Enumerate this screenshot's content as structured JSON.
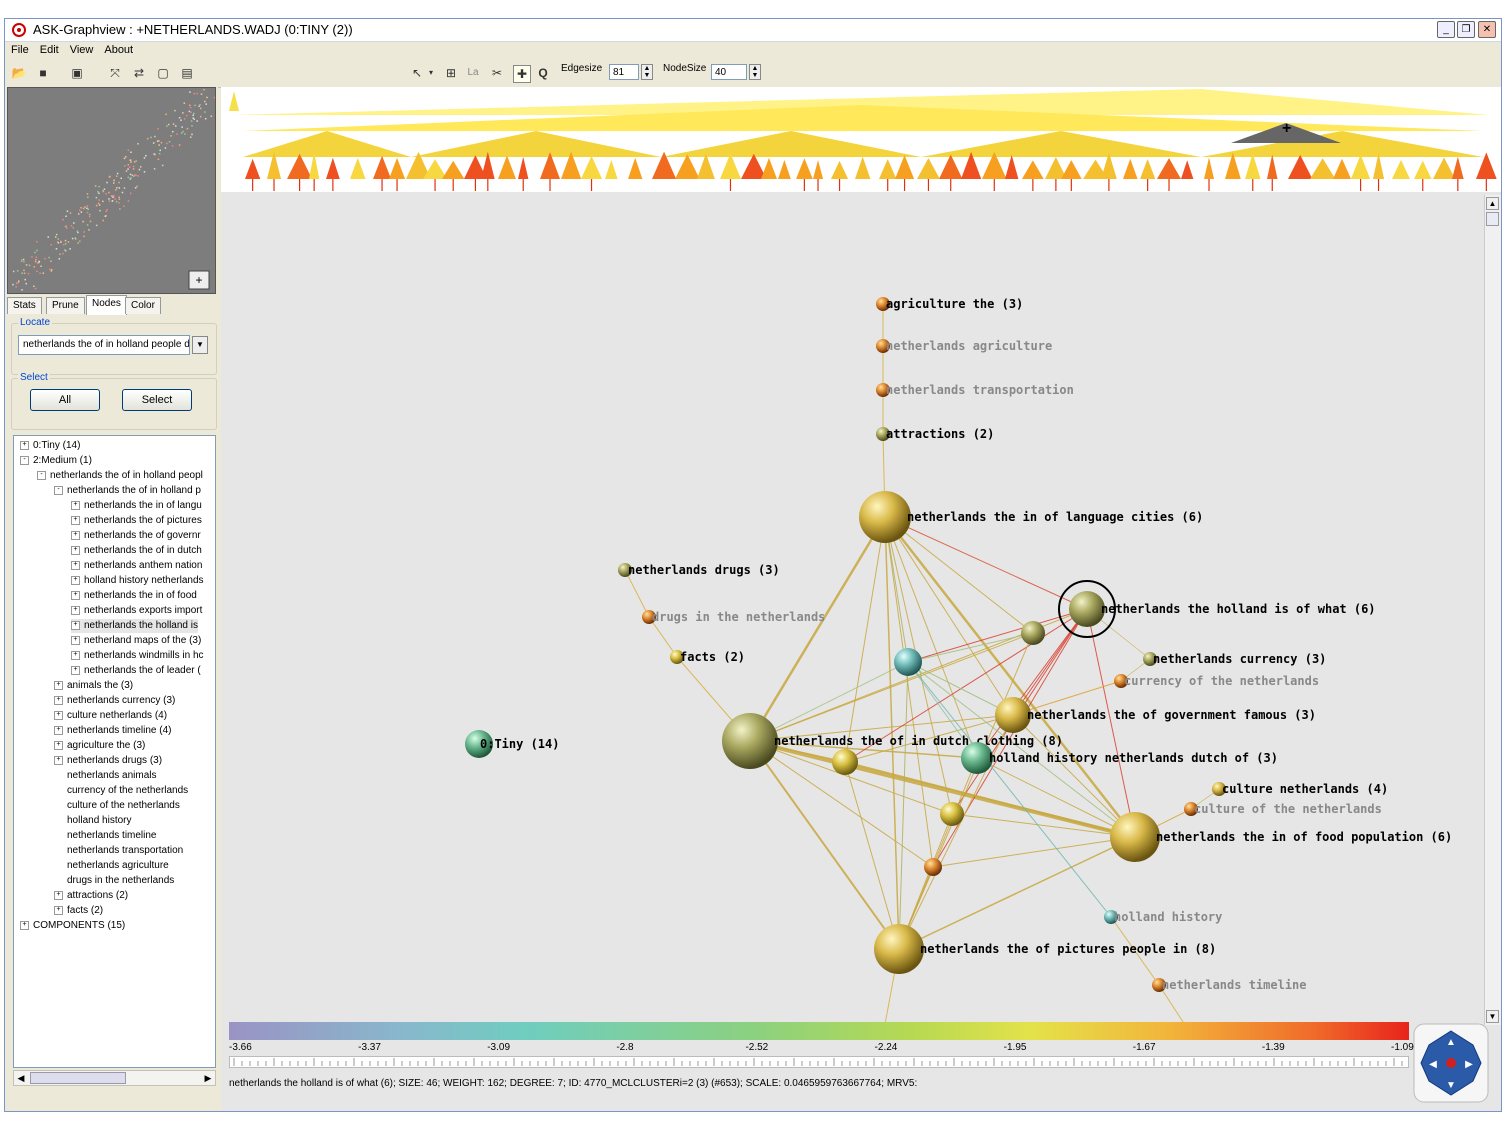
{
  "window": {
    "title": "ASK-Graphview : +NETHERLANDS.WADJ (0:TINY (2))"
  },
  "menu": [
    "File",
    "Edit",
    "View",
    "About"
  ],
  "toolbar": {
    "edgesize_label": "Edgesize",
    "edgesize_value": "81",
    "nodesize_label": "NodeSize",
    "nodesize_value": "40",
    "layout_label": "La",
    "query_label": "Q"
  },
  "tabs": [
    "Stats",
    "Prune",
    "Nodes",
    "Color"
  ],
  "active_tab": "Nodes",
  "locate": {
    "label": "Locate",
    "value": "netherlands the of in holland people d"
  },
  "select": {
    "label": "Select",
    "all_button": "All",
    "select_button": "Select"
  },
  "tree": [
    {
      "label": "0:Tiny (14)",
      "indent": 0,
      "exp": "+"
    },
    {
      "label": "2:Medium (1)",
      "indent": 0,
      "exp": "-"
    },
    {
      "label": "netherlands the of in holland peopl",
      "indent": 1,
      "exp": "-"
    },
    {
      "label": "netherlands the of in holland p",
      "indent": 2,
      "exp": "-"
    },
    {
      "label": "netherlands the in of langu",
      "indent": 3,
      "exp": "+"
    },
    {
      "label": "netherlands the of pictures",
      "indent": 3,
      "exp": "+"
    },
    {
      "label": "netherlands the of governr",
      "indent": 3,
      "exp": "+"
    },
    {
      "label": "netherlands the of in dutch",
      "indent": 3,
      "exp": "+"
    },
    {
      "label": "netherlands anthem nation",
      "indent": 3,
      "exp": "+"
    },
    {
      "label": "holland history netherlands",
      "indent": 3,
      "exp": "+"
    },
    {
      "label": "netherlands the in of food",
      "indent": 3,
      "exp": "+"
    },
    {
      "label": "netherlands exports import",
      "indent": 3,
      "exp": "+"
    },
    {
      "label": "netherlands the holland is",
      "indent": 3,
      "exp": "+",
      "selected": true
    },
    {
      "label": "netherland maps of the (3)",
      "indent": 3,
      "exp": "+"
    },
    {
      "label": "netherlands windmills in hc",
      "indent": 3,
      "exp": "+"
    },
    {
      "label": "netherlands the of leader (",
      "indent": 3,
      "exp": "+"
    },
    {
      "label": "animals the (3)",
      "indent": 2,
      "exp": "+"
    },
    {
      "label": "netherlands currency (3)",
      "indent": 2,
      "exp": "+"
    },
    {
      "label": "culture netherlands (4)",
      "indent": 2,
      "exp": "+"
    },
    {
      "label": "netherlands timeline (4)",
      "indent": 2,
      "exp": "+"
    },
    {
      "label": "agriculture the (3)",
      "indent": 2,
      "exp": "+"
    },
    {
      "label": "netherlands drugs (3)",
      "indent": 2,
      "exp": "+"
    },
    {
      "label": "netherlands animals",
      "indent": 2,
      "exp": ""
    },
    {
      "label": "currency of the netherlands",
      "indent": 2,
      "exp": ""
    },
    {
      "label": "culture of the netherlands",
      "indent": 2,
      "exp": ""
    },
    {
      "label": "holland history",
      "indent": 2,
      "exp": ""
    },
    {
      "label": "netherlands timeline",
      "indent": 2,
      "exp": ""
    },
    {
      "label": "netherlands transportation",
      "indent": 2,
      "exp": ""
    },
    {
      "label": "netherlands agriculture",
      "indent": 2,
      "exp": ""
    },
    {
      "label": "drugs in the netherlands",
      "indent": 2,
      "exp": ""
    },
    {
      "label": "attractions (2)",
      "indent": 2,
      "exp": "+"
    },
    {
      "label": "facts (2)",
      "indent": 2,
      "exp": "+"
    },
    {
      "label": "COMPONENTS (15)",
      "indent": 0,
      "exp": "+"
    }
  ],
  "graph": {
    "nodes": [
      {
        "id": "agri",
        "label": "agriculture the (3)",
        "gray": false
      },
      {
        "id": "nagri",
        "label": "netherlands agriculture",
        "gray": true
      },
      {
        "id": "ntrans",
        "label": "netherlands transportation",
        "gray": true
      },
      {
        "id": "attr",
        "label": "attractions (2)",
        "gray": false
      },
      {
        "id": "lang",
        "label": "netherlands the in of language cities (6)",
        "gray": false
      },
      {
        "id": "drugs",
        "label": "netherlands drugs (3)",
        "gray": false
      },
      {
        "id": "dnl",
        "label": "drugs in the netherlands",
        "gray": true
      },
      {
        "id": "facts",
        "label": "facts (2)",
        "gray": false
      },
      {
        "id": "tiny",
        "label": "0:Tiny (14)",
        "gray": false
      },
      {
        "id": "holland",
        "label": "netherlands the holland is of what (6)",
        "gray": false
      },
      {
        "id": "curr",
        "label": "netherlands currency (3)",
        "gray": false
      },
      {
        "id": "cnl",
        "label": "currency of the netherlands",
        "gray": true
      },
      {
        "id": "gov",
        "label": "netherlands the of government famous (3)",
        "gray": false
      },
      {
        "id": "dutch",
        "label": "netherlands the of in dutch clothing (8)",
        "gray": false
      },
      {
        "id": "hhist",
        "label": "holland history netherlands dutch of (3)",
        "gray": false
      },
      {
        "id": "cult",
        "label": "culture netherlands (4)",
        "gray": false
      },
      {
        "id": "conl",
        "label": "culture of the netherlands",
        "gray": true
      },
      {
        "id": "food",
        "label": "netherlands the in of food population (6)",
        "gray": false
      },
      {
        "id": "hh",
        "label": "holland history",
        "gray": true
      },
      {
        "id": "pict",
        "label": "netherlands the of pictures people in (8)",
        "gray": false
      },
      {
        "id": "ntl",
        "label": "netherlands timeline",
        "gray": true
      },
      {
        "id": "nanim",
        "label": "netherlands animals",
        "gray": true
      },
      {
        "id": "tl",
        "label": "netherlands timeline (4)",
        "gray": false
      },
      {
        "id": "anim",
        "label": "animals the (3)",
        "gray": false
      }
    ]
  },
  "colorbar": {
    "ticks": [
      "-3.66",
      "-3.37",
      "-3.09",
      "-2.8",
      "-2.52",
      "-2.24",
      "-1.95",
      "-1.67",
      "-1.39",
      "-1.09"
    ]
  },
  "status": "netherlands the holland is of what (6);   SIZE: 46;   WEIGHT: 162;   DEGREE: 7;   ID: 4770_MCLCLUSTERi=2 (3) (#653);   SCALE: 0.0465959763667764;   MRV5:"
}
